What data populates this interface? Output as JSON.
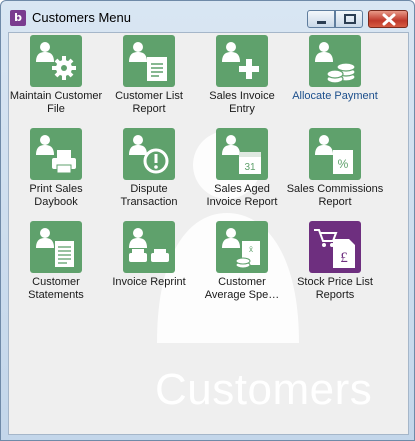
{
  "window": {
    "title": "Customers Menu",
    "app_icon_letter": "b"
  },
  "watermark": "Customers",
  "tiles": [
    {
      "label": "Maintain Customer\nFile",
      "icon": "customer-settings-icon"
    },
    {
      "label": "Customer List\nReport",
      "icon": "customer-report-icon"
    },
    {
      "label": "Sales Invoice\nEntry",
      "icon": "customer-add-icon"
    },
    {
      "label": "Allocate Payment",
      "icon": "customer-coins-icon"
    },
    {
      "label": "Print Sales\nDaybook",
      "icon": "customer-printer-icon"
    },
    {
      "label": "Dispute\nTransaction",
      "icon": "customer-alert-icon"
    },
    {
      "label": "Sales Aged\nInvoice Report",
      "icon": "customer-calendar-icon"
    },
    {
      "label": "Sales Commissions\nReport",
      "icon": "customer-percent-icon"
    },
    {
      "label": "Customer\nStatements",
      "icon": "customer-statement-icon"
    },
    {
      "label": "Invoice Reprint",
      "icon": "customer-reprint-icon"
    },
    {
      "label": "Customer\nAverage Spe…",
      "icon": "customer-spend-icon"
    },
    {
      "label": "Stock Price List\nReports",
      "icon": "stock-price-list-icon"
    }
  ],
  "colors": {
    "tile_green": "#5fa16c",
    "tile_purple": "#6e2f7f",
    "link_blue": "#1c4f8c"
  }
}
